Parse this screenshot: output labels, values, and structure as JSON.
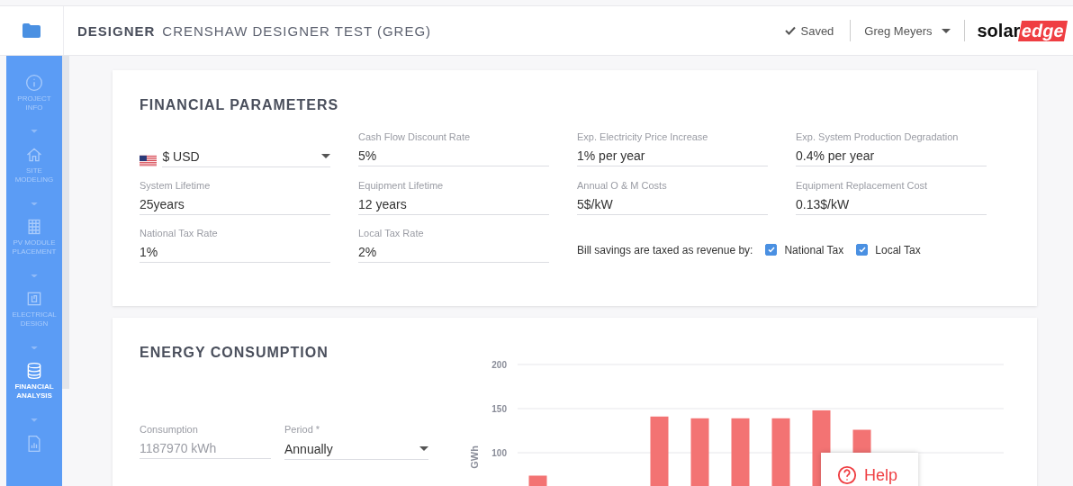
{
  "header": {
    "title": "DESIGNER",
    "project": "CRENSHAW DESIGNER TEST (GREG)",
    "status": "Saved",
    "user": "Greg Meyers",
    "logo_left": "solar",
    "logo_right": "edge"
  },
  "sidebar": {
    "items": [
      {
        "label": "PROJECT INFO",
        "kind": "info",
        "selected": false
      },
      {
        "label": "SITE MODELING",
        "kind": "home",
        "selected": false
      },
      {
        "label": "PV MODULE PLACEMENT",
        "kind": "grid",
        "selected": false
      },
      {
        "label": "ELECTRICAL DESIGN",
        "kind": "circuit",
        "selected": false
      },
      {
        "label": "FINANCIAL ANALYSIS",
        "kind": "database",
        "selected": true
      },
      {
        "kind": "report",
        "selected": false
      }
    ]
  },
  "financial": {
    "title": "FINANCIAL PARAMETERS",
    "fields": [
      {
        "kind": "currency",
        "value": "$ USD"
      },
      {
        "kind": "text",
        "label": "Cash Flow Discount Rate",
        "value": "5%"
      },
      {
        "kind": "text",
        "label": "Exp. Electricity Price Increase",
        "value": "1% per year"
      },
      {
        "kind": "text",
        "label": "Exp. System Production Degradation",
        "value": "0.4% per year"
      },
      {
        "kind": "text",
        "label": "System Lifetime",
        "value": "25years"
      },
      {
        "kind": "text",
        "label": "Equipment Lifetime",
        "value": "12 years"
      },
      {
        "kind": "text",
        "label": "Annual O & M Costs",
        "value": "5$/kW"
      },
      {
        "kind": "text",
        "label": "Equipment Replacement Cost",
        "value": "0.13$/kW"
      },
      {
        "kind": "text",
        "label": "National Tax Rate",
        "value": "1%"
      },
      {
        "kind": "text",
        "label": "Local Tax Rate",
        "value": "2%"
      }
    ],
    "tax_label": "Bill savings are taxed as revenue by:",
    "tax_options": [
      {
        "label": "National Tax",
        "checked": true
      },
      {
        "label": "Local Tax",
        "checked": true
      }
    ]
  },
  "energy": {
    "title": "ENERGY CONSUMPTION",
    "consumption": {
      "label": "Consumption",
      "value": "1187970 kWh",
      "disabled": true
    },
    "period": {
      "label": "Period *",
      "value": "Annually"
    },
    "chart_data": {
      "type": "bar",
      "ylabel": "GWh",
      "ylim": [
        0,
        200
      ],
      "yticks": [
        100,
        150,
        200
      ],
      "series": [
        {
          "color": "#f37373",
          "values": [
            74,
            null,
            null,
            141,
            139,
            139,
            139,
            148,
            126,
            null,
            null,
            null
          ]
        }
      ]
    }
  },
  "help": {
    "label": "Help"
  }
}
